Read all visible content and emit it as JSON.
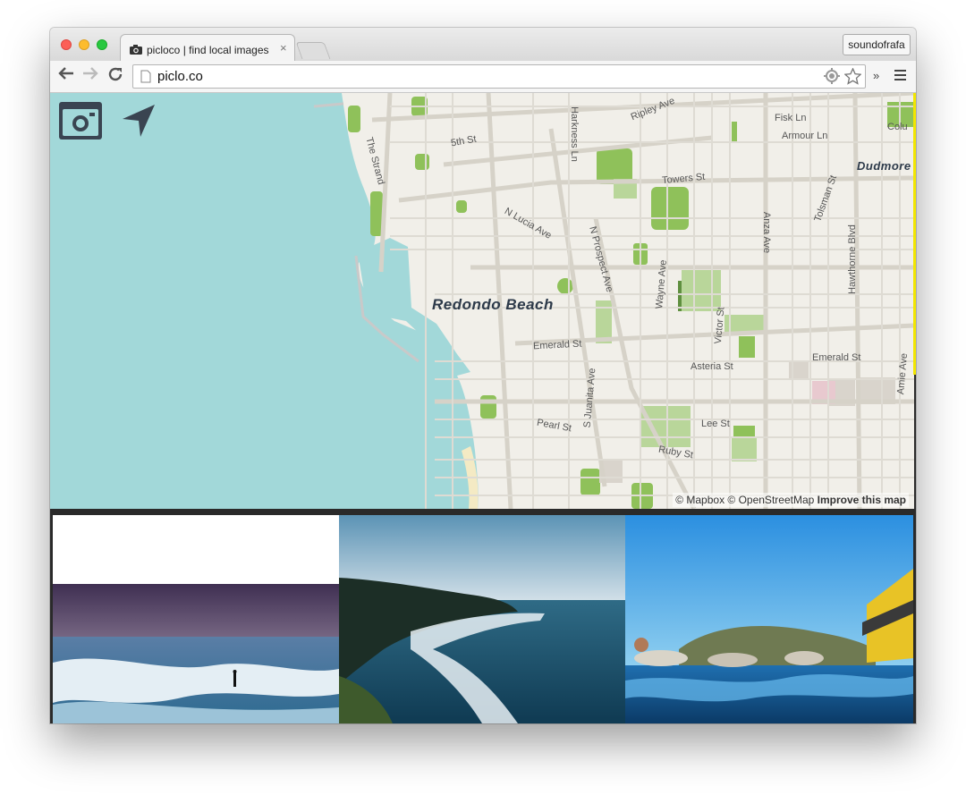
{
  "browser": {
    "tab_title": "picloco | find local images",
    "tab_close": "×",
    "profile_name": "soundofrafa",
    "url": "piclo.co",
    "overflow_label": "»"
  },
  "map": {
    "city_label": "Redondo Beach",
    "city_label_ne": "Dudmore",
    "street_labels": {
      "ripley": "Ripley Ave",
      "fisk": "Fisk Ln",
      "armour": "Armour Ln",
      "colum": "Colu",
      "fifth": "5th St",
      "strand": "The Strand",
      "harkness": "Harkness Ln",
      "towers": "Towers St",
      "tolsman": "Tolsman St",
      "lucia": "N Lucia Ave",
      "prospect": "N Prospect Ave",
      "anza": "Anza Ave",
      "hawthorne": "Hawthorne Blvd",
      "wayne": "Wayne Ave",
      "victor": "Victor St",
      "emerald1": "Emerald St",
      "emerald2": "Emerald St",
      "asteria": "Asteria St",
      "amie": "Amie Ave",
      "juanita": "S Juanita Ave",
      "pearl": "Pearl St",
      "lee": "Lee St",
      "ruby": "Ruby St"
    },
    "attribution": "© Mapbox © OpenStreetMap",
    "improve_link": "Improve this map",
    "controls": {
      "camera_icon": "camera-icon",
      "locate_icon": "location-arrow-icon"
    },
    "colors": {
      "water": "#a2d8d9",
      "park": "#8fc15a",
      "land": "#f1efe9"
    }
  },
  "photos": [
    {
      "icon": "surfer-at-beach-photo"
    },
    {
      "icon": "coastline-cliffs-photo"
    },
    {
      "icon": "swimmers-in-ocean-photo"
    }
  ]
}
